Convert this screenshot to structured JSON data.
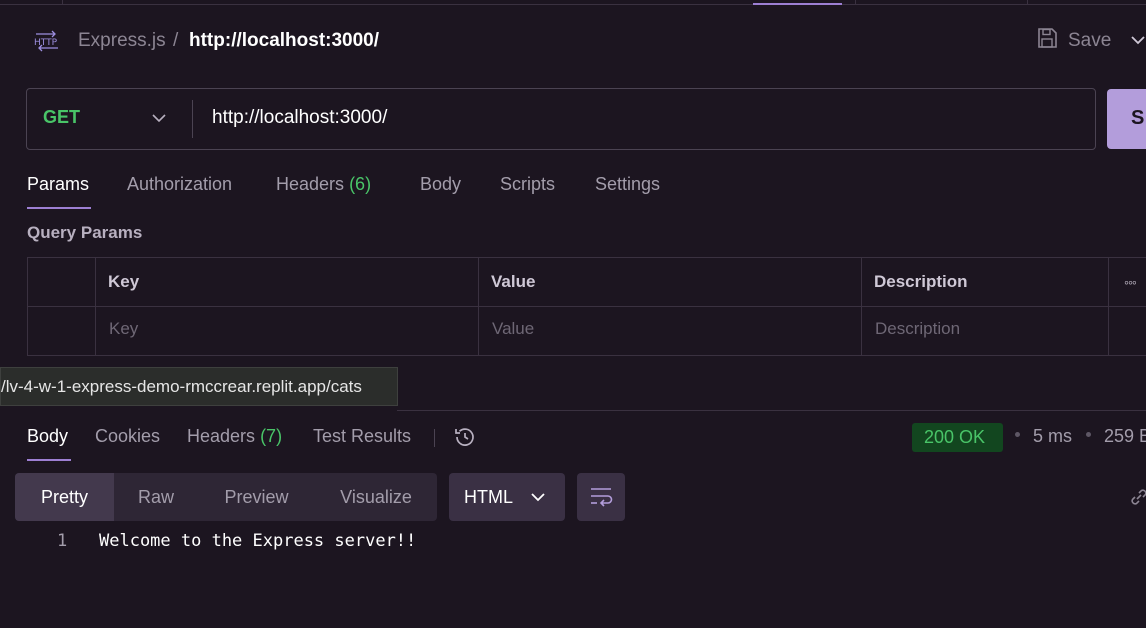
{
  "header": {
    "breadcrumb_parent": "Express.js",
    "breadcrumb_separator": "/",
    "breadcrumb_current": "http://localhost:3000/",
    "save_label": "Save",
    "icon": "http-icon"
  },
  "request": {
    "method": "GET",
    "url": "http://localhost:3000/",
    "send_label": "S"
  },
  "request_tabs": [
    {
      "label": "Params",
      "count": ""
    },
    {
      "label": "Authorization",
      "count": ""
    },
    {
      "label": "Headers",
      "count": "(6)"
    },
    {
      "label": "Body",
      "count": ""
    },
    {
      "label": "Scripts",
      "count": ""
    },
    {
      "label": "Settings",
      "count": ""
    }
  ],
  "query_params": {
    "title": "Query Params",
    "columns": [
      "Key",
      "Value",
      "Description"
    ],
    "placeholders": [
      "Key",
      "Value",
      "Description"
    ]
  },
  "tooltip": "/lv-4-w-1-express-demo-rmccrear.replit.app/cats",
  "response_tabs": [
    {
      "label": "Body",
      "count": ""
    },
    {
      "label": "Cookies",
      "count": ""
    },
    {
      "label": "Headers",
      "count": "(7)"
    },
    {
      "label": "Test Results",
      "count": ""
    }
  ],
  "response_meta": {
    "status": "200 OK",
    "time": "5 ms",
    "size": "259 B"
  },
  "view_modes": [
    "Pretty",
    "Raw",
    "Preview",
    "Visualize"
  ],
  "format": "HTML",
  "body_lines": [
    {
      "number": "1",
      "text": "Welcome to the Express server!!"
    }
  ],
  "colors": {
    "accent": "#9d7fd3",
    "method_get": "#49c468",
    "send_button": "#b39ddb",
    "status_ok_bg": "#12461f"
  }
}
